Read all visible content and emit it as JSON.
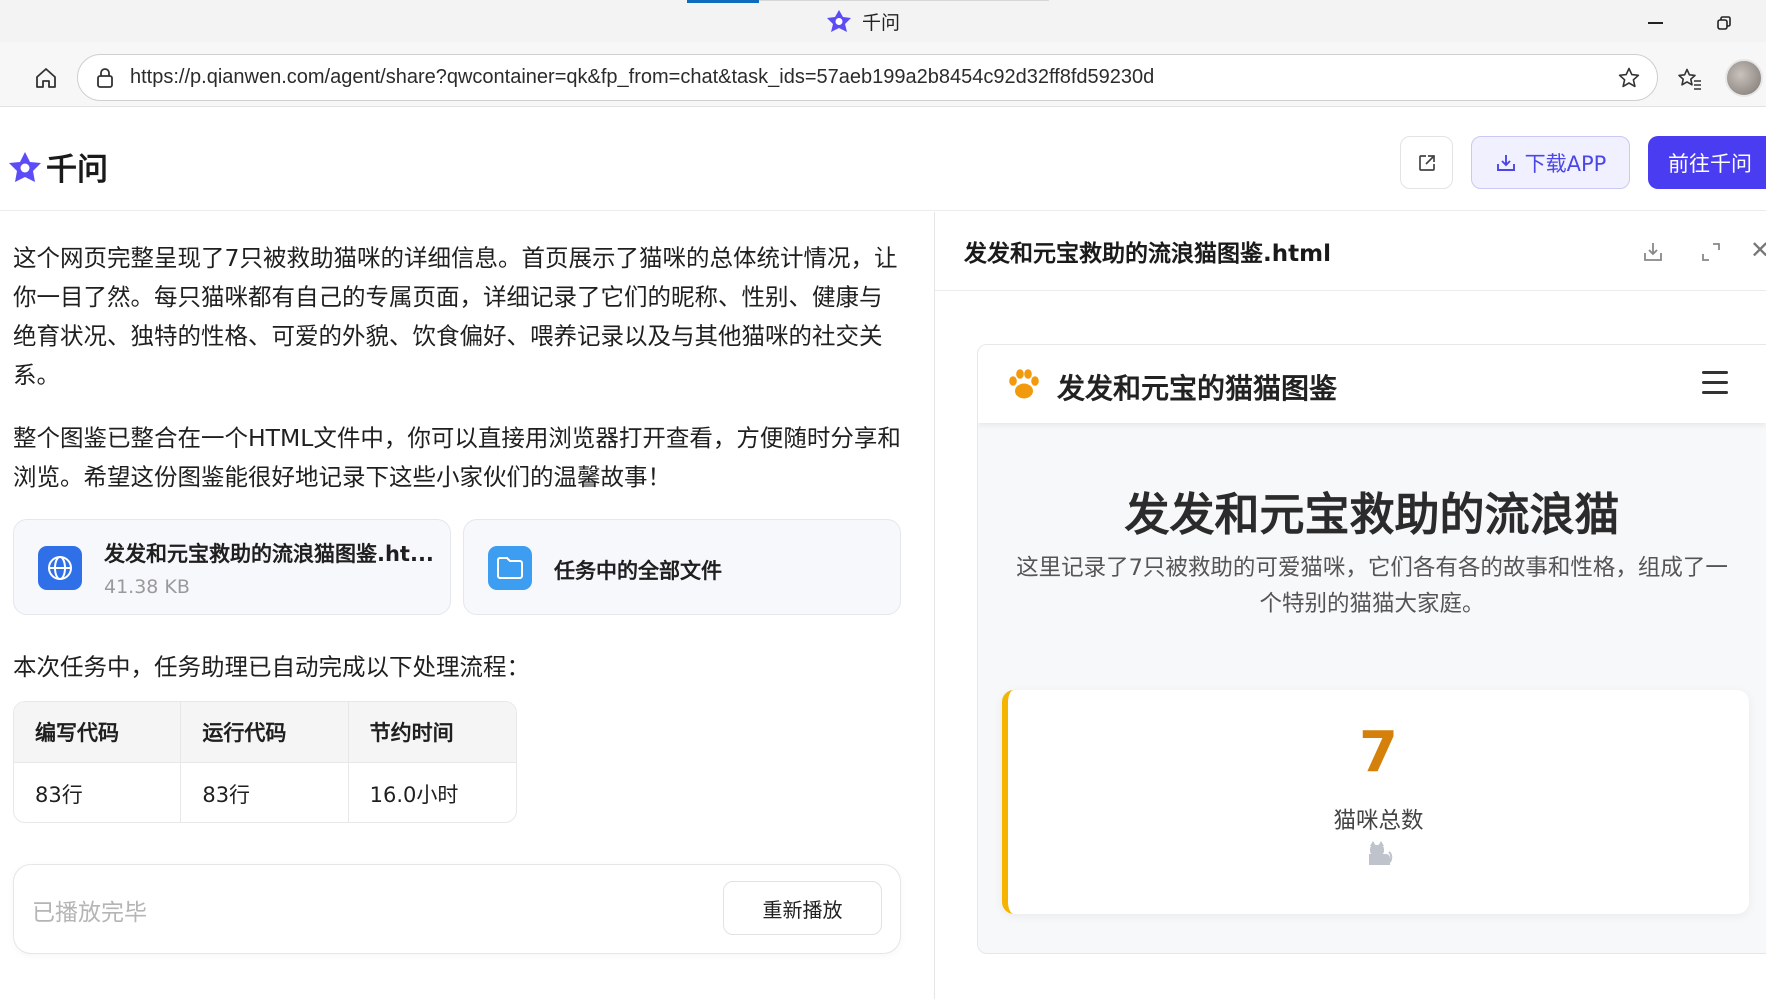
{
  "browser": {
    "tab_title": "千问",
    "url": "https://p.qianwen.com/agent/share?qwcontainer=qk&fp_from=chat&task_ids=57aeb199a2b8454c92d32ff8fd59230d"
  },
  "header": {
    "brand": "千问",
    "download_label": "下载APP",
    "go_label": "前往千问"
  },
  "chat": {
    "paragraph1": "这个网页完整呈现了7只被救助猫咪的详细信息。首页展示了猫咪的总体统计情况，让你一目了然。每只猫咪都有自己的专属页面，详细记录了它们的昵称、性别、健康与绝育状况、独特的性格、可爱的外貌、饮食偏好、喂养记录以及与其他猫咪的社交关系。",
    "paragraph2": "整个图鉴已整合在一个HTML文件中，你可以直接用浏览器打开查看，方便随时分享和浏览。希望这份图鉴能很好地记录下这些小家伙们的温馨故事！",
    "file_card": {
      "name": "发发和元宝救助的流浪猫图鉴.ht...",
      "size": "41.38 KB"
    },
    "all_files_label": "任务中的全部文件",
    "flow_text": "本次任务中，任务助理已自动完成以下处理流程：",
    "table": {
      "headers": [
        "编写代码",
        "运行代码",
        "节约时间"
      ],
      "values": [
        "83行",
        "83行",
        "16.0小时"
      ]
    },
    "player_status": "已播放完毕",
    "replay_label": "重新播放"
  },
  "preview": {
    "file_title": "发发和元宝救助的流浪猫图鉴.html",
    "site": {
      "brand": "发发和元宝的猫猫图鉴",
      "hero_title": "发发和元宝救助的流浪猫",
      "hero_subtitle": "这里记录了7只被救助的可爱猫咪，它们各有各的故事和性格，组成了一个特别的猫猫大家庭。",
      "stat_number": "7",
      "stat_label": "猫咪总数"
    }
  },
  "colors": {
    "brand_purple": "#4a3cf0",
    "accent_orange": "#d4800b",
    "accent_yellow": "#f5b400"
  },
  "icons": [
    "qianwen-logo",
    "minimize-icon",
    "restore-icon",
    "home-icon",
    "lock-icon",
    "star-icon",
    "favorites-icon",
    "share-icon",
    "download-icon",
    "globe-icon",
    "folder-icon",
    "expand-icon",
    "close-icon",
    "paw-icon",
    "menu-icon",
    "cat-icon"
  ]
}
